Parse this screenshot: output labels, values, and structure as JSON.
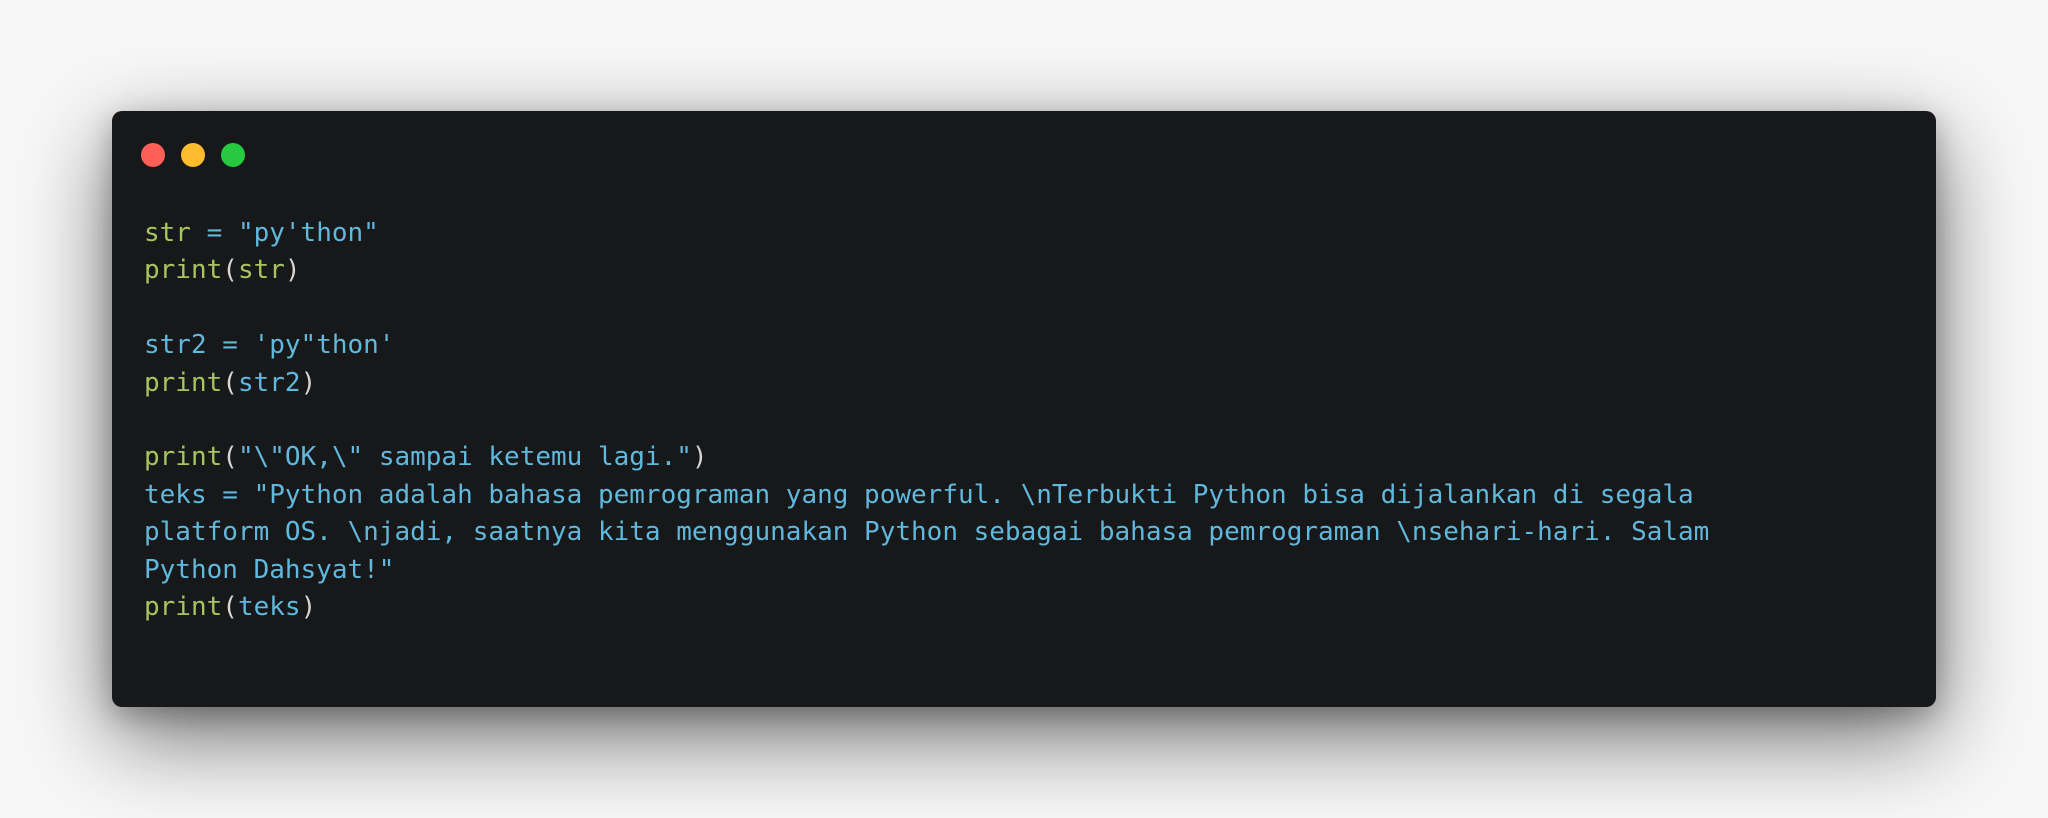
{
  "window": {
    "buttons": [
      {
        "name": "close",
        "color": "#ff5f57"
      },
      {
        "name": "minimize",
        "color": "#febc2e"
      },
      {
        "name": "maximize",
        "color": "#28c840"
      }
    ]
  },
  "colors": {
    "background": "#17181a",
    "builtin": "#a6c55e",
    "identifier": "#61b8dd",
    "punctuation": "#d6d6d6"
  },
  "code": {
    "lines": [
      [
        {
          "t": "str",
          "k": "b"
        },
        {
          "t": " = ",
          "k": "i"
        },
        {
          "t": "\"py'thon\"",
          "k": "i"
        }
      ],
      [
        {
          "t": "print",
          "k": "b"
        },
        {
          "t": "(",
          "k": "p"
        },
        {
          "t": "str",
          "k": "b"
        },
        {
          "t": ")",
          "k": "p"
        }
      ],
      [],
      [
        {
          "t": "str2 = ",
          "k": "i"
        },
        {
          "t": "'py\"thon'",
          "k": "i"
        }
      ],
      [
        {
          "t": "print",
          "k": "b"
        },
        {
          "t": "(",
          "k": "p"
        },
        {
          "t": "str2",
          "k": "i"
        },
        {
          "t": ")",
          "k": "p"
        }
      ],
      [],
      [
        {
          "t": "print",
          "k": "b"
        },
        {
          "t": "(",
          "k": "p"
        },
        {
          "t": "\"\\\"OK,\\\" sampai ketemu lagi.\"",
          "k": "i"
        },
        {
          "t": ")",
          "k": "p"
        }
      ],
      [
        {
          "t": "teks = ",
          "k": "i"
        },
        {
          "t": "\"Python adalah bahasa pemrograman yang powerful. \\nTerbukti Python bisa dijalankan di segala",
          "k": "i"
        }
      ],
      [
        {
          "t": "platform OS. \\njadi, saatnya kita menggunakan Python sebagai bahasa pemrograman \\nsehari-hari. Salam",
          "k": "i"
        }
      ],
      [
        {
          "t": "Python Dahsyat!\"",
          "k": "i"
        }
      ],
      [
        {
          "t": "print",
          "k": "b"
        },
        {
          "t": "(",
          "k": "p"
        },
        {
          "t": "teks",
          "k": "i"
        },
        {
          "t": ")",
          "k": "p"
        }
      ]
    ]
  }
}
